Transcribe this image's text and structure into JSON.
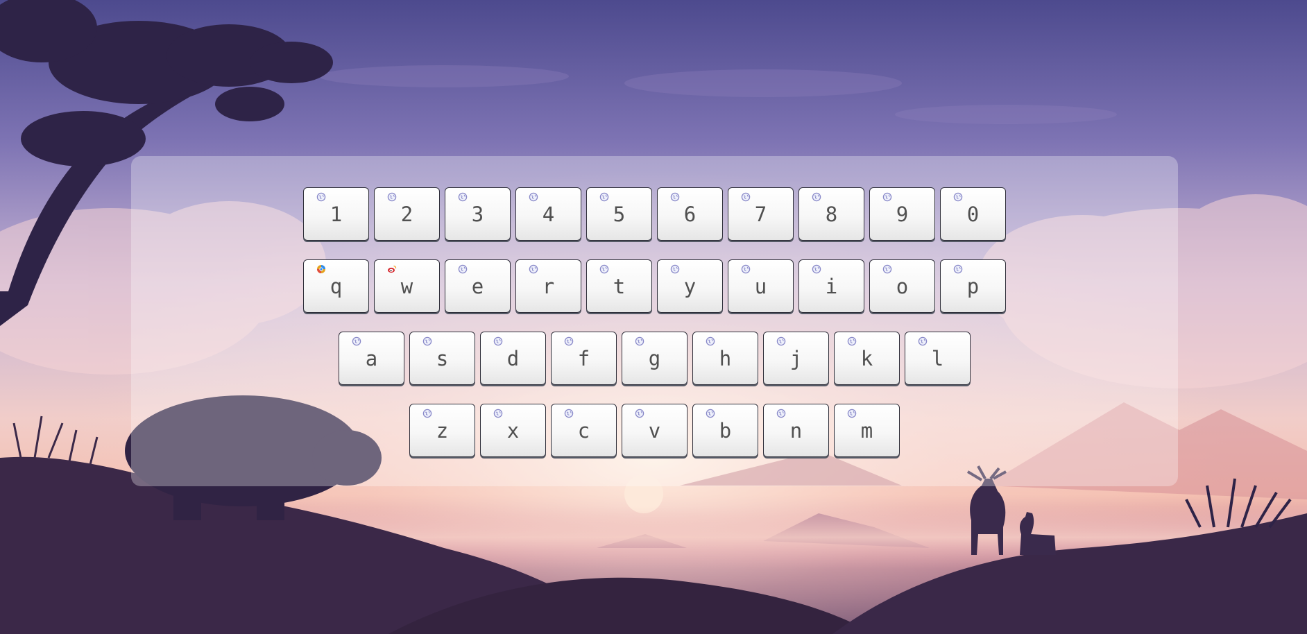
{
  "app": {
    "colors": {
      "sky_top": "#5a5296",
      "sky_mid": "#a592c4",
      "horizon": "#f3c9c3",
      "sun_glow": "#fbe6d6",
      "ground": "#3c2647",
      "silhouette": "#2b2140",
      "key_text": "#505050",
      "key_border": "#2f2f3a",
      "globe_icon": "#8888c8"
    }
  },
  "keyboard": {
    "rows": [
      {
        "keys": [
          {
            "label": "1",
            "icon": "globe-icon"
          },
          {
            "label": "2",
            "icon": "globe-icon"
          },
          {
            "label": "3",
            "icon": "globe-icon"
          },
          {
            "label": "4",
            "icon": "globe-icon"
          },
          {
            "label": "5",
            "icon": "globe-icon"
          },
          {
            "label": "6",
            "icon": "globe-icon"
          },
          {
            "label": "7",
            "icon": "globe-icon"
          },
          {
            "label": "8",
            "icon": "globe-icon"
          },
          {
            "label": "9",
            "icon": "globe-icon"
          },
          {
            "label": "0",
            "icon": "globe-icon"
          }
        ]
      },
      {
        "keys": [
          {
            "label": "q",
            "icon": "browser-favicon-icon"
          },
          {
            "label": "w",
            "icon": "weibo-favicon-icon"
          },
          {
            "label": "e",
            "icon": "globe-icon"
          },
          {
            "label": "r",
            "icon": "globe-icon"
          },
          {
            "label": "t",
            "icon": "globe-icon"
          },
          {
            "label": "y",
            "icon": "globe-icon"
          },
          {
            "label": "u",
            "icon": "globe-icon"
          },
          {
            "label": "i",
            "icon": "globe-icon"
          },
          {
            "label": "o",
            "icon": "globe-icon"
          },
          {
            "label": "p",
            "icon": "globe-icon"
          }
        ]
      },
      {
        "keys": [
          {
            "label": "a",
            "icon": "globe-icon"
          },
          {
            "label": "s",
            "icon": "globe-icon"
          },
          {
            "label": "d",
            "icon": "globe-icon"
          },
          {
            "label": "f",
            "icon": "globe-icon"
          },
          {
            "label": "g",
            "icon": "globe-icon"
          },
          {
            "label": "h",
            "icon": "globe-icon"
          },
          {
            "label": "j",
            "icon": "globe-icon"
          },
          {
            "label": "k",
            "icon": "globe-icon"
          },
          {
            "label": "l",
            "icon": "globe-icon"
          }
        ]
      },
      {
        "keys": [
          {
            "label": "z",
            "icon": "globe-icon"
          },
          {
            "label": "x",
            "icon": "globe-icon"
          },
          {
            "label": "c",
            "icon": "globe-icon"
          },
          {
            "label": "v",
            "icon": "globe-icon"
          },
          {
            "label": "b",
            "icon": "globe-icon"
          },
          {
            "label": "n",
            "icon": "globe-icon"
          },
          {
            "label": "m",
            "icon": "globe-icon"
          }
        ]
      }
    ]
  }
}
